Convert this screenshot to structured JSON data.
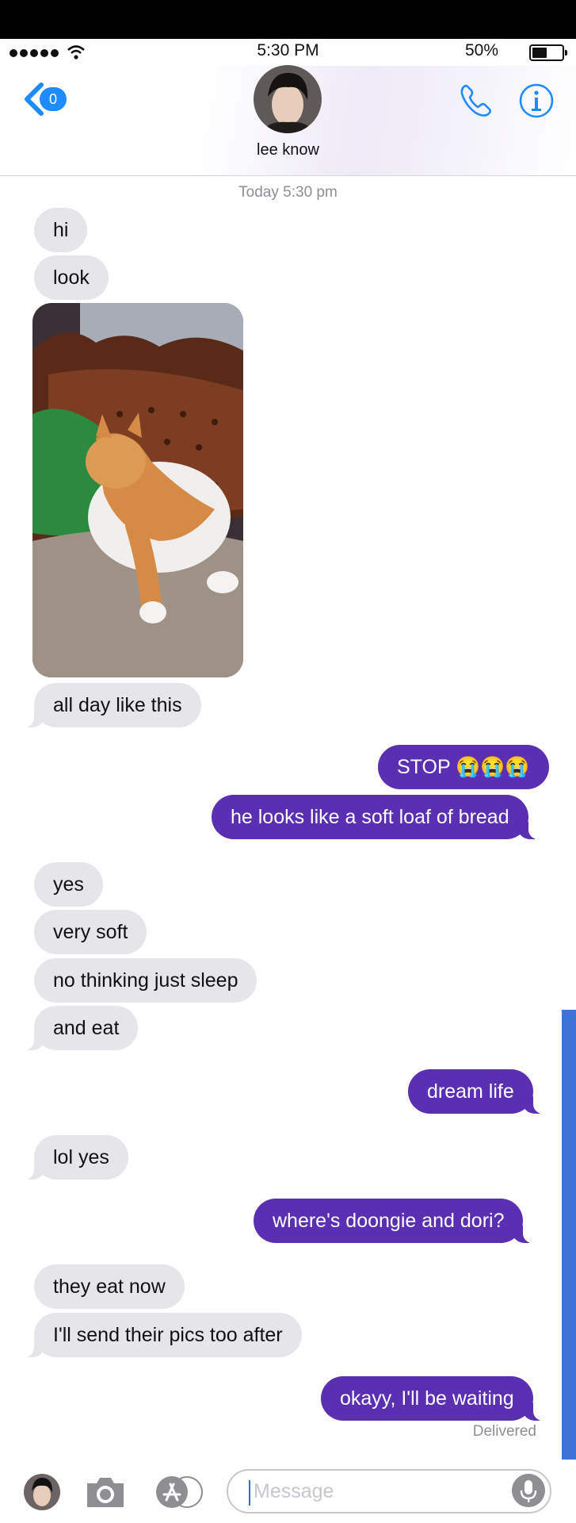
{
  "status_bar": {
    "time": "5:30 PM",
    "battery": "50%"
  },
  "header": {
    "back_badge": "0",
    "contact_name": "lee know"
  },
  "timestamp": "Today 5:30 pm",
  "messages": [
    {
      "from": "them",
      "text": "hi"
    },
    {
      "from": "them",
      "text": "look"
    },
    {
      "from": "them",
      "text": "all day like this"
    },
    {
      "from": "me",
      "text": "STOP 😭😭😭"
    },
    {
      "from": "me",
      "text": "he looks like a soft loaf of bread"
    },
    {
      "from": "them",
      "text": "yes"
    },
    {
      "from": "them",
      "text": "very soft"
    },
    {
      "from": "them",
      "text": "no thinking just sleep"
    },
    {
      "from": "them",
      "text": "and eat"
    },
    {
      "from": "me",
      "text": "dream life"
    },
    {
      "from": "them",
      "text": "lol yes"
    },
    {
      "from": "me",
      "text": "where's doongie and dori?"
    },
    {
      "from": "them",
      "text": "they eat now"
    },
    {
      "from": "them",
      "text": "I'll send their pics too after"
    },
    {
      "from": "me",
      "text": "okayy, I'll be waiting"
    }
  ],
  "delivered_label": "Delivered",
  "input": {
    "placeholder": "Message"
  },
  "colors": {
    "outgoing": "#5a2fb1",
    "incoming": "#e5e5ea",
    "accent": "#1e8cff"
  },
  "icons": [
    "back-chevron-icon",
    "phone-icon",
    "info-icon",
    "camera-icon",
    "app-store-icon",
    "microphone-icon"
  ]
}
